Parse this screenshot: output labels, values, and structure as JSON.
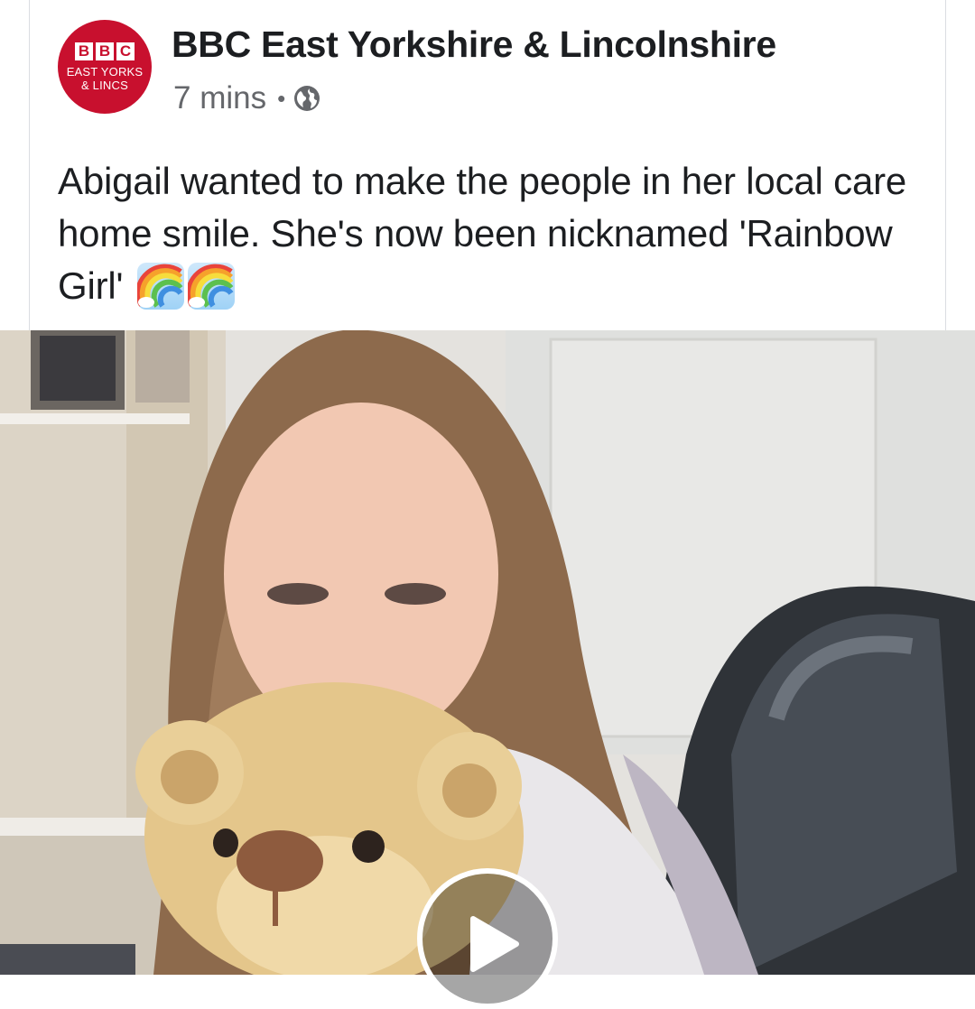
{
  "post": {
    "page_name": "BBC East Yorkshire & Lincolnshire",
    "avatar": {
      "bbc_letters": [
        "B",
        "B",
        "C"
      ],
      "line1": "EAST YORKS",
      "line2": "& LINCS",
      "brand_color": "#c8102e"
    },
    "timestamp": "7 mins",
    "separator": "•",
    "audience_icon": "globe-icon",
    "text": "Abigail wanted to make the people in her local care home smile. She's now been nicknamed 'Rainbow Girl'",
    "emojis": [
      "rainbow-emoji",
      "rainbow-emoji"
    ]
  },
  "media": {
    "type": "video",
    "play_icon": "play-icon"
  },
  "colors": {
    "text_primary": "#1c1e21",
    "text_secondary": "#65676b"
  }
}
